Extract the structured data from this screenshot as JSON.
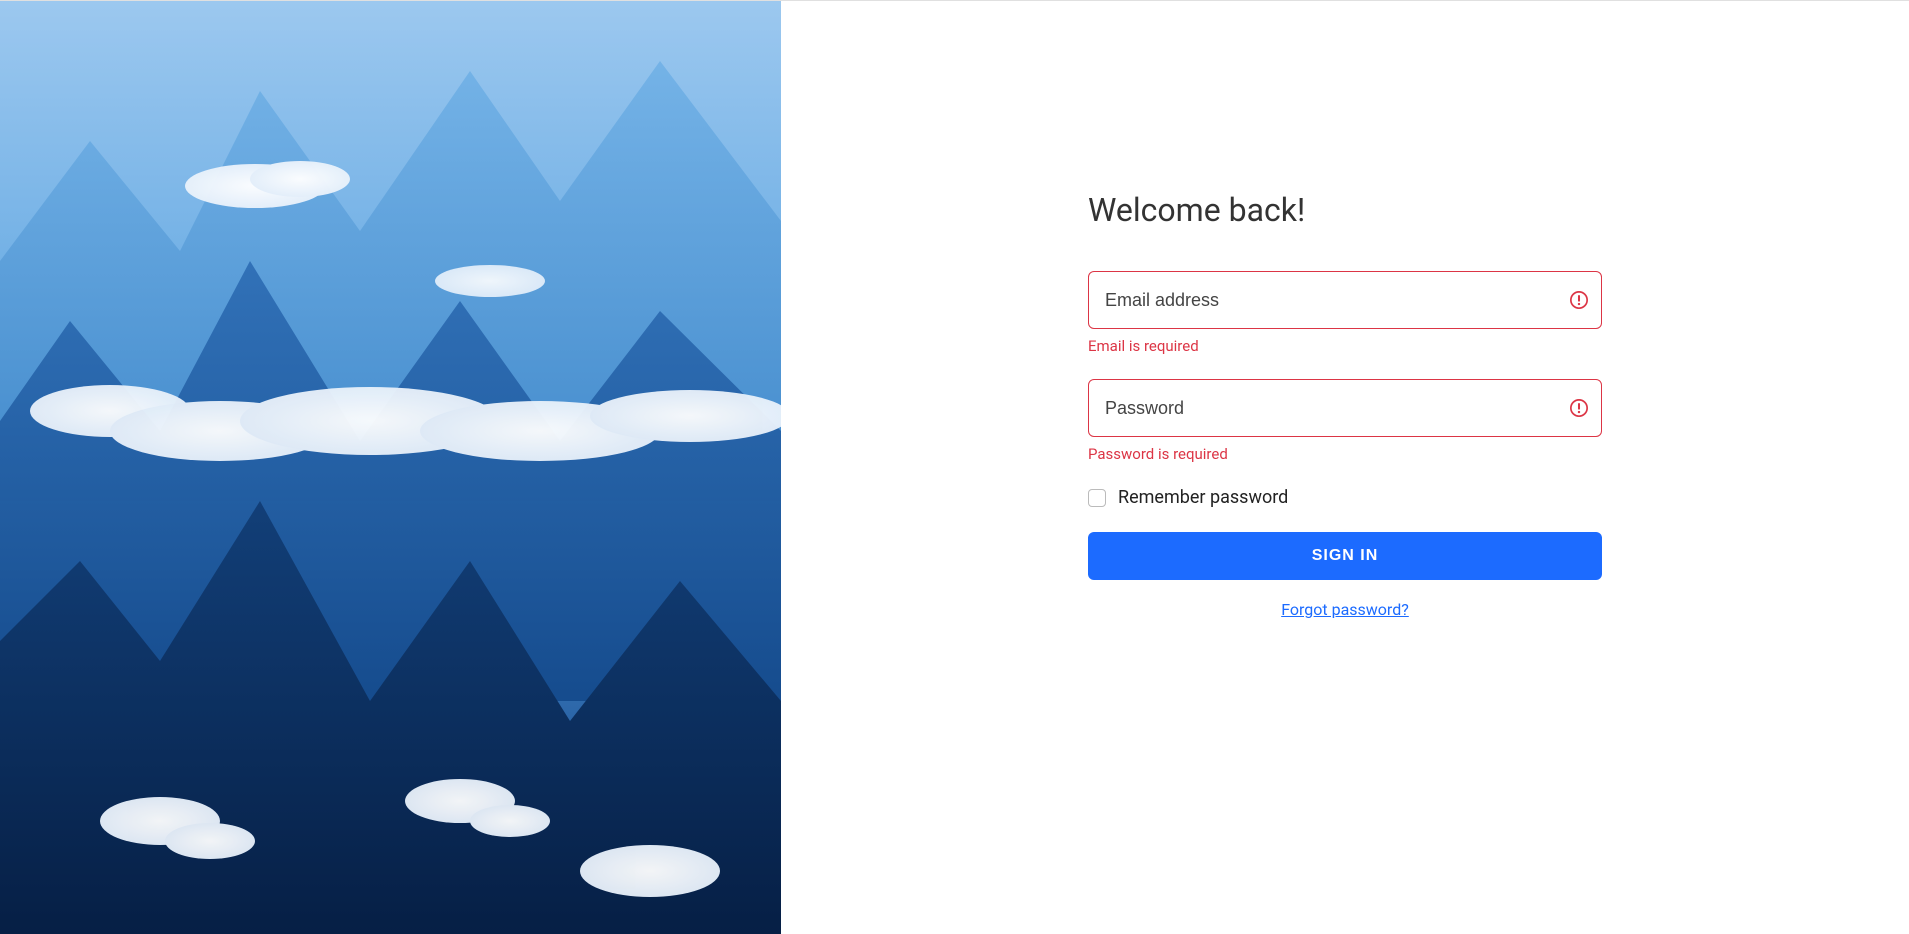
{
  "login": {
    "title": "Welcome back!",
    "email": {
      "placeholder": "Email address",
      "value": "",
      "error": "Email is required"
    },
    "password": {
      "placeholder": "Password",
      "value": "",
      "error": "Password is required"
    },
    "remember_label": "Remember password",
    "signin_label": "Sign In",
    "forgot_label": "Forgot password?"
  },
  "colors": {
    "primary": "#1c6bff",
    "danger": "#dc3545"
  }
}
